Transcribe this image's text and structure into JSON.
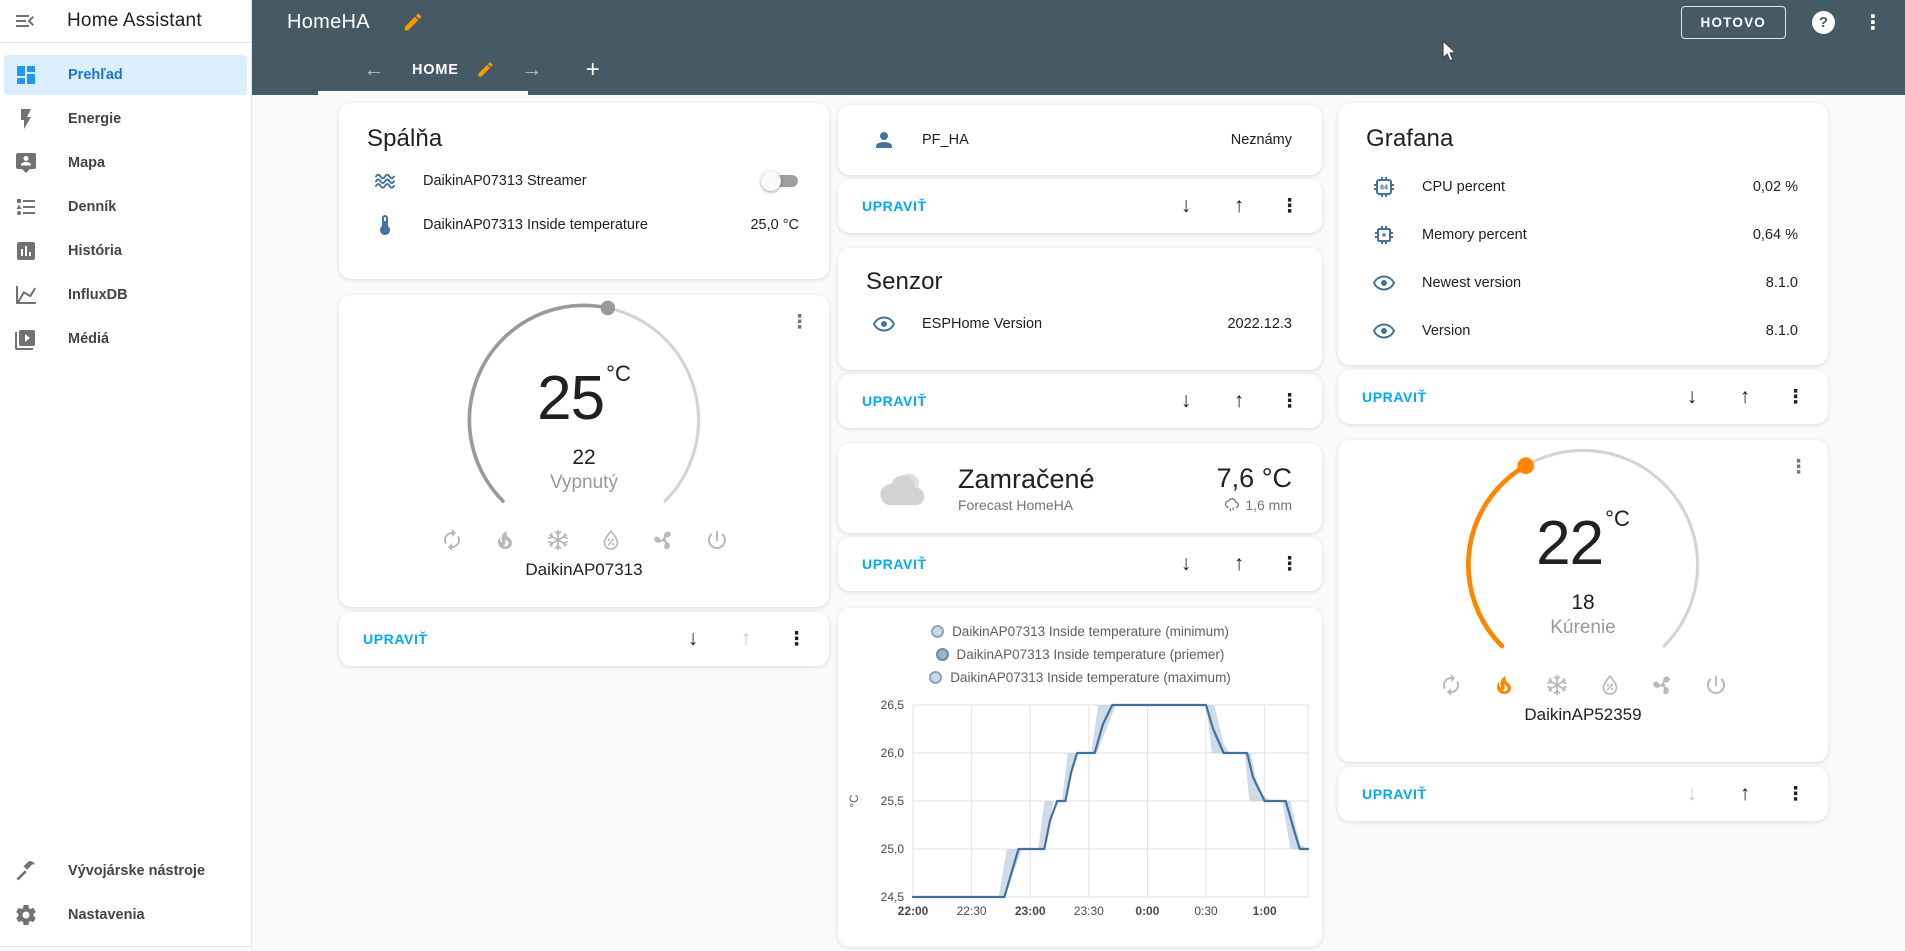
{
  "app": {
    "title": "Home Assistant"
  },
  "sidebar": {
    "items": [
      {
        "label": "Prehľad",
        "icon": "view-dashboard",
        "active": true
      },
      {
        "label": "Energie",
        "icon": "lightning-bolt",
        "active": false
      },
      {
        "label": "Mapa",
        "icon": "tooltip-account",
        "active": false
      },
      {
        "label": "Denník",
        "icon": "format-list-bulleted",
        "active": false
      },
      {
        "label": "História",
        "icon": "chart-box",
        "active": false
      },
      {
        "label": "InfluxDB",
        "icon": "chart-line",
        "active": false
      },
      {
        "label": "Médiá",
        "icon": "play-box-multiple",
        "active": false
      }
    ],
    "bottom_items": [
      {
        "label": "Vývojárske nástroje",
        "icon": "hammer"
      },
      {
        "label": "Nastavenia",
        "icon": "cog"
      }
    ]
  },
  "header": {
    "dashboard_title": "HomeHA",
    "done_button": "HOTOVO",
    "tab": {
      "label": "HOME"
    },
    "add_tab": "+"
  },
  "edit_footer": {
    "label": "UPRAVIŤ"
  },
  "cards": {
    "spalna": {
      "title": "Spálňa",
      "rows": [
        {
          "name": "DaikinAP07313 Streamer",
          "control": "toggle-off"
        },
        {
          "name": "DaikinAP07313 Inside temperature",
          "value": "25,0 °C"
        }
      ]
    },
    "thermostat1": {
      "current": "25",
      "unit": "°C",
      "target": "22",
      "mode_label": "Vypnutý",
      "device": "DaikinAP07313",
      "active_mode": ""
    },
    "pf_ha": {
      "name": "PF_HA",
      "value": "Neznámy"
    },
    "senzor": {
      "title": "Senzor",
      "rows": [
        {
          "name": "ESPHome Version",
          "value": "2022.12.3"
        }
      ]
    },
    "weather": {
      "condition": "Zamračené",
      "source": "Forecast HomeHA",
      "temperature": "7,6 °C",
      "precipitation": "1,6 mm"
    },
    "grafana": {
      "title": "Grafana",
      "rows": [
        {
          "name": "CPU percent",
          "value": "0,02 %"
        },
        {
          "name": "Memory percent",
          "value": "0,64 %"
        },
        {
          "name": "Newest version",
          "value": "8.1.0"
        },
        {
          "name": "Version",
          "value": "8.1.0"
        }
      ]
    },
    "thermostat2": {
      "current": "22",
      "unit": "°C",
      "target": "18",
      "mode_label": "Kúrenie",
      "device": "DaikinAP52359",
      "active_mode": "heat"
    }
  },
  "chart_data": {
    "type": "line",
    "title": "",
    "ylabel": "°C",
    "legend": [
      {
        "label": "DaikinAP07313 Inside temperature (minimum)",
        "style": "light"
      },
      {
        "label": "DaikinAP07313 Inside temperature (priemer)",
        "style": "dark"
      },
      {
        "label": "DaikinAP07313 Inside temperature (maximum)",
        "style": "light"
      }
    ],
    "x_range": [
      0,
      3.37
    ],
    "y_range": [
      24.5,
      26.5
    ],
    "x_ticks": [
      {
        "t": 0.0,
        "label": "22:00",
        "bold": true
      },
      {
        "t": 0.5,
        "label": "22:30",
        "bold": false
      },
      {
        "t": 1.0,
        "label": "23:00",
        "bold": true
      },
      {
        "t": 1.5,
        "label": "23:30",
        "bold": false
      },
      {
        "t": 2.0,
        "label": "0:00",
        "bold": true
      },
      {
        "t": 2.5,
        "label": "0:30",
        "bold": false
      },
      {
        "t": 3.0,
        "label": "1:00",
        "bold": true
      }
    ],
    "y_ticks": [
      {
        "v": 24.5,
        "label": "24,5"
      },
      {
        "v": 25.0,
        "label": "25,0"
      },
      {
        "v": 25.5,
        "label": "25,5"
      },
      {
        "v": 26.0,
        "label": "26,0"
      },
      {
        "v": 26.5,
        "label": "26,5"
      }
    ],
    "grid": true,
    "legend_position": "top",
    "series": {
      "priemer": [
        [
          0,
          24.5
        ],
        [
          0.78,
          24.5
        ],
        [
          0.9,
          25
        ],
        [
          1.12,
          25
        ],
        [
          1.17,
          25.3
        ],
        [
          1.23,
          25.5
        ],
        [
          1.3,
          25.5
        ],
        [
          1.35,
          25.8
        ],
        [
          1.4,
          26
        ],
        [
          1.55,
          26
        ],
        [
          1.62,
          26.3
        ],
        [
          1.7,
          26.5
        ],
        [
          2.5,
          26.5
        ],
        [
          2.56,
          26.25
        ],
        [
          2.65,
          26
        ],
        [
          2.85,
          26
        ],
        [
          2.9,
          25.75
        ],
        [
          3.0,
          25.5
        ],
        [
          3.18,
          25.5
        ],
        [
          3.25,
          25.2
        ],
        [
          3.3,
          25
        ],
        [
          3.37,
          25
        ]
      ],
      "maximum": [
        [
          0,
          24.5
        ],
        [
          0.73,
          24.5
        ],
        [
          0.8,
          25
        ],
        [
          1.07,
          25
        ],
        [
          1.12,
          25.5
        ],
        [
          1.27,
          25.5
        ],
        [
          1.32,
          26
        ],
        [
          1.52,
          26
        ],
        [
          1.58,
          26.5
        ],
        [
          2.57,
          26.5
        ],
        [
          2.65,
          26.1
        ],
        [
          2.7,
          26
        ],
        [
          2.88,
          26
        ],
        [
          2.95,
          25.6
        ],
        [
          3.05,
          25.5
        ],
        [
          3.22,
          25.5
        ],
        [
          3.3,
          25.05
        ],
        [
          3.37,
          25
        ]
      ],
      "minimum": [
        [
          0,
          24.5
        ],
        [
          0.78,
          24.5
        ],
        [
          0.93,
          25
        ],
        [
          1.12,
          25
        ],
        [
          1.2,
          25.5
        ],
        [
          1.3,
          25.5
        ],
        [
          1.4,
          26
        ],
        [
          1.57,
          26
        ],
        [
          1.73,
          26.5
        ],
        [
          2.5,
          26.5
        ],
        [
          2.55,
          26
        ],
        [
          2.83,
          26
        ],
        [
          2.87,
          25.5
        ],
        [
          3.15,
          25.5
        ],
        [
          3.22,
          25
        ],
        [
          3.37,
          25
        ]
      ]
    },
    "colors": {
      "line": "#43719f",
      "band": "#b6c8d9",
      "grid": "#e2e2e2",
      "tick_text": "#4a4a4a"
    }
  },
  "colors": {
    "accent": "#03a9f4",
    "header": "#455a64",
    "entity_icon": "#44739e",
    "edit_pencil": "#ff9800",
    "heat": "#ff8700"
  }
}
